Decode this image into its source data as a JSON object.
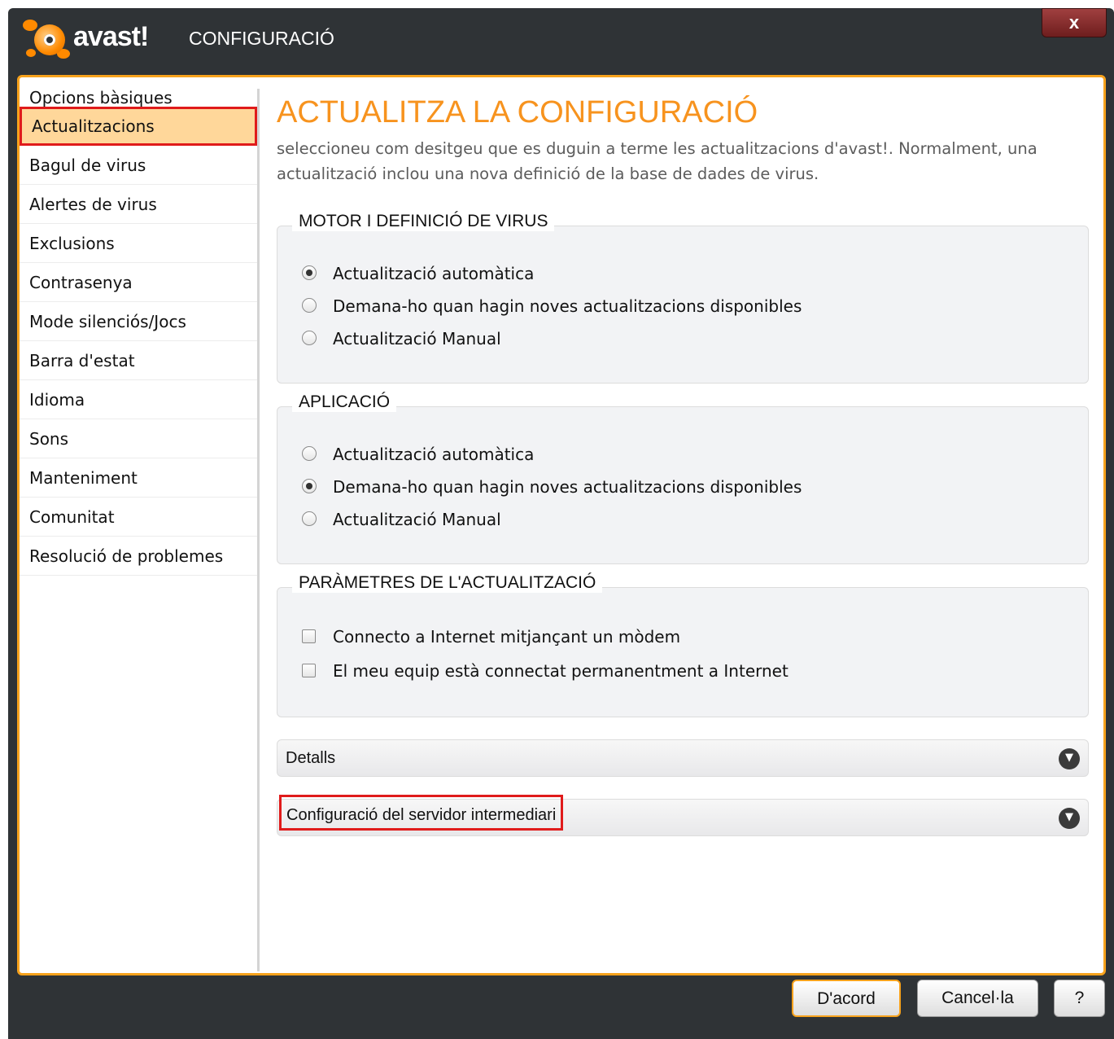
{
  "window": {
    "logo_text": "avast!",
    "title": "CONFIGURACIÓ",
    "close_label": "x"
  },
  "sidebar": {
    "items": [
      {
        "label": "Opcions bàsiques",
        "active": false
      },
      {
        "label": "Actualitzacions",
        "active": true
      },
      {
        "label": "Bagul de virus",
        "active": false
      },
      {
        "label": "Alertes de virus",
        "active": false
      },
      {
        "label": "Exclusions",
        "active": false
      },
      {
        "label": "Contrasenya",
        "active": false
      },
      {
        "label": "Mode silenciós/Jocs",
        "active": false
      },
      {
        "label": "Barra d'estat",
        "active": false
      },
      {
        "label": "Idioma",
        "active": false
      },
      {
        "label": "Sons",
        "active": false
      },
      {
        "label": "Manteniment",
        "active": false
      },
      {
        "label": "Comunitat",
        "active": false
      },
      {
        "label": "Resolució de problemes",
        "active": false
      }
    ]
  },
  "main": {
    "heading": "ACTUALITZA LA CONFIGURACIÓ",
    "description": "seleccioneu com desitgeu que es duguin a terme les actualitzacions d'avast!. Normalment, una actualització inclou una nova definició de la base de dades de virus.",
    "groups": [
      {
        "legend": "MOTOR I DEFINICIÓ DE VIRUS",
        "options": [
          {
            "label": "Actualització automàtica",
            "checked": true
          },
          {
            "label": "Demana-ho quan hagin noves actualitzacions disponibles",
            "checked": false
          },
          {
            "label": "Actualització Manual",
            "checked": false
          }
        ]
      },
      {
        "legend": "APLICACIÓ",
        "options": [
          {
            "label": "Actualització automàtica",
            "checked": false
          },
          {
            "label": "Demana-ho quan hagin noves actualitzacions disponibles",
            "checked": true
          },
          {
            "label": "Actualització Manual",
            "checked": false
          }
        ]
      },
      {
        "legend": "PARÀMETRES DE L'ACTUALITZACIÓ",
        "checkboxes": [
          {
            "label": "Connecto a Internet mitjançant un mòdem",
            "checked": false
          },
          {
            "label": "El meu equip està connectat permanentment a Internet",
            "checked": false
          }
        ]
      }
    ],
    "sections": [
      {
        "label": "Detalls",
        "expanded": false
      },
      {
        "label": "Configuració del servidor intermediari",
        "expanded": false
      }
    ]
  },
  "footer": {
    "ok_label": "D'acord",
    "cancel_label": "Cancel·la",
    "help_label": "?"
  },
  "colors": {
    "accent": "#f7a21c",
    "heading": "#f7931e",
    "highlight": "#e01b1b",
    "titlebar": "#2f3336"
  },
  "icons": {
    "close": "close-icon",
    "expand": "chevron-down-icon"
  }
}
